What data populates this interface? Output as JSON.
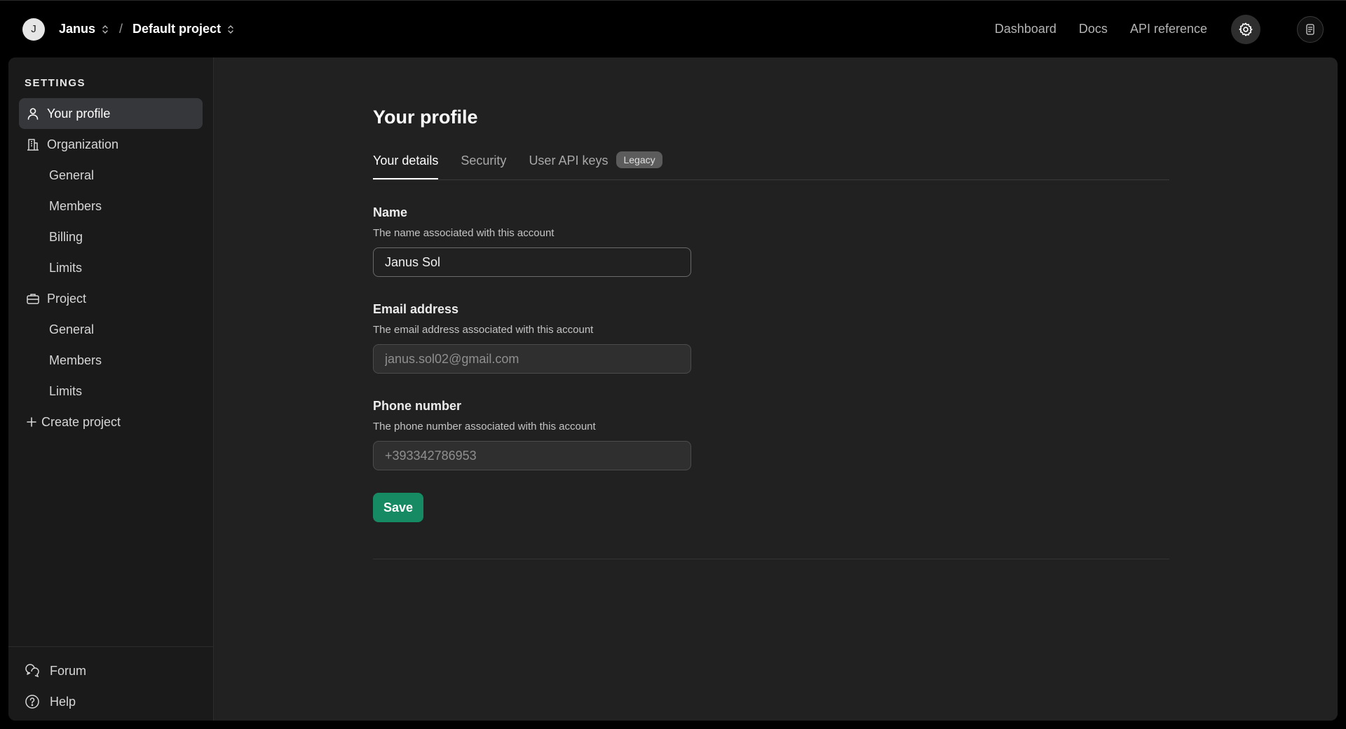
{
  "topbar": {
    "avatar_initial": "J",
    "org_name": "Janus",
    "separator": "/",
    "project_name": "Default project",
    "nav": [
      "Dashboard",
      "Docs",
      "API reference"
    ],
    "icons": [
      "settings-icon",
      "user-account-icon"
    ]
  },
  "sidebar": {
    "title": "SETTINGS",
    "items": [
      {
        "label": "Your profile",
        "icon": "person-icon",
        "active": true
      },
      {
        "label": "Organization",
        "icon": "building-icon"
      },
      {
        "label": "General"
      },
      {
        "label": "Members"
      },
      {
        "label": "Billing"
      },
      {
        "label": "Limits"
      },
      {
        "label": "Project",
        "icon": "briefcase-icon"
      },
      {
        "label": "General"
      },
      {
        "label": "Members"
      },
      {
        "label": "Limits"
      },
      {
        "label": "Create project",
        "icon": "plus-icon"
      }
    ],
    "footer": [
      {
        "label": "Forum",
        "icon": "chat-bubbles-icon"
      },
      {
        "label": "Help",
        "icon": "question-circle-icon"
      }
    ]
  },
  "main": {
    "title": "Your profile",
    "tabs": [
      {
        "label": "Your details",
        "active": true
      },
      {
        "label": "Security"
      },
      {
        "label": "User API keys",
        "badge": "Legacy"
      }
    ],
    "fields": {
      "name": {
        "label": "Name",
        "description": "The name associated with this account",
        "value": "Janus Sol"
      },
      "email": {
        "label": "Email address",
        "description": "The email address associated with this account",
        "placeholder": "janus.sol02@gmail.com"
      },
      "phone": {
        "label": "Phone number",
        "description": "The phone number associated with this account",
        "placeholder": "+393342786953"
      }
    },
    "save_label": "Save"
  },
  "colors": {
    "background": "#000000",
    "panel": "#212121",
    "sidebar": "#1a1a1a",
    "active_item": "#36373b",
    "save_button": "#168a63"
  }
}
